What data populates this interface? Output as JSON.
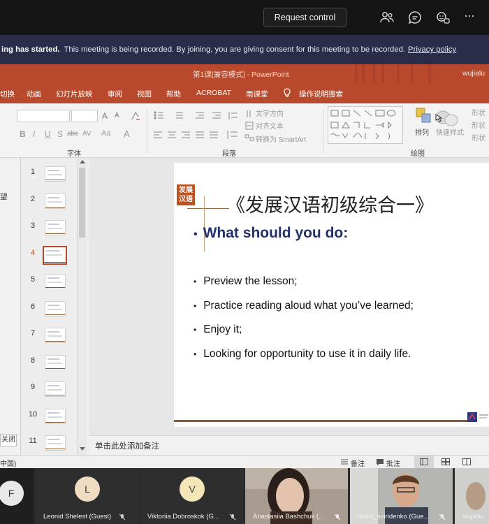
{
  "topbar": {
    "request_control_label": "Request control",
    "icons": [
      "people-icon",
      "chat-icon",
      "reactions-icon",
      "more-icon"
    ],
    "more_label": "···"
  },
  "banner": {
    "started_text": "ing has started.",
    "message": "This meeting is being recorded. By joining, you are giving consent for this meeting to be recorded.",
    "privacy_link": "Privacy policy"
  },
  "powerpoint": {
    "title": "第1课[兼容模式] - PowerPoint",
    "user": "wujialu",
    "tabs": [
      "切换",
      "动画",
      "幻灯片放映",
      "审阅",
      "视图",
      "帮助",
      "ACROBAT",
      "雨课堂",
      "操作说明搜索"
    ],
    "ribbon": {
      "font_group_label": "字体",
      "paragraph_group_label": "段落",
      "drawing_group_label": "绘图",
      "text_direction": "文字方向",
      "align_text": "对齐文本",
      "convert_smartart": "转换为 SmartArt",
      "arrange": "排列",
      "quick_styles": "快速样式",
      "font_buttons": [
        "B",
        "I",
        "U",
        "S",
        "abc",
        "AV",
        "Aa",
        "A"
      ],
      "grow_shrink": [
        "A",
        "A"
      ],
      "right_items": [
        "形状",
        "形状",
        "形状"
      ]
    }
  },
  "left_pane": {
    "label": "望",
    "close_label": "关闭"
  },
  "thumbnails": {
    "numbers": [
      "1",
      "2",
      "3",
      "4",
      "5",
      "6",
      "7",
      "8",
      "9",
      "10",
      "11"
    ],
    "selected": "4"
  },
  "slide": {
    "logo_line1": "发展",
    "logo_line2": "汉语",
    "title": "《发展汉语初级综合一》",
    "heading": "What should you do:",
    "bullets": [
      "Preview the lesson;",
      "Practice reading aloud what you’ve learned;",
      "Enjoy it;",
      "Looking for opportunity to use it in daily life."
    ],
    "bullet_glyph": "•"
  },
  "notes_placeholder": "单击此处添加备注",
  "statusbar": {
    "language": "中国)",
    "notes_label": "备注",
    "comments_label": "批注"
  },
  "participants": [
    {
      "initial": "F",
      "name": "",
      "avatar_color": "#e8e8e8"
    },
    {
      "initial": "L",
      "name": "Leonid Shelest (Guest)",
      "avatar_color": "#f0dcc0"
    },
    {
      "initial": "V",
      "name": "Viktoriia.Dobroskok (G...",
      "avatar_color": "#f5e6b8"
    },
    {
      "initial": "",
      "name": "Anastasiia Bashchuk (...",
      "avatar_color": ""
    },
    {
      "initial": "",
      "name": "denis_sviridenko (Gue...",
      "avatar_color": ""
    },
    {
      "initial": "",
      "name": "wujialu",
      "avatar_color": ""
    }
  ]
}
